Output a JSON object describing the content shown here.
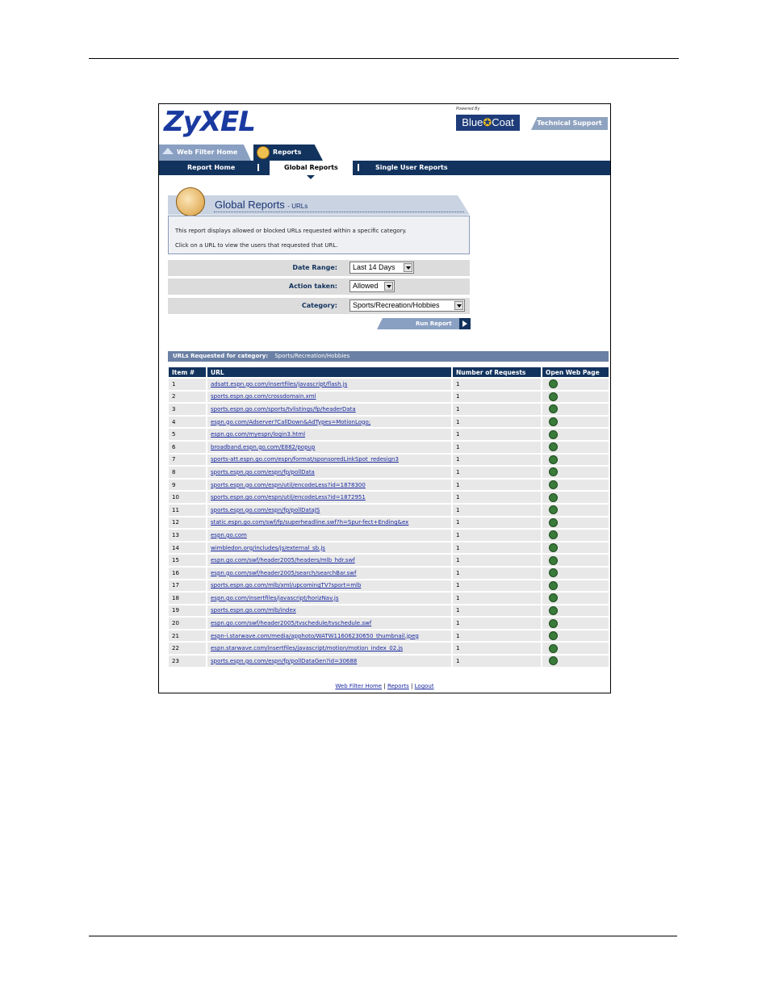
{
  "header": {
    "logo_text": "ZyXEL",
    "powered_by": "Powered By",
    "partner_logo": "BlueCoat",
    "tech_support_label": "Technical Support"
  },
  "tabs": [
    {
      "label": "Web Filter Home",
      "icon": "home-icon"
    },
    {
      "label": "Reports",
      "icon": "reports-icon"
    }
  ],
  "subnav": {
    "report_home": "Report Home",
    "global_reports": "Global Reports",
    "single_user_reports": "Single User Reports"
  },
  "section": {
    "title": "Global Reports",
    "subtitle": "- URLs",
    "desc_line1": "This report displays allowed or blocked URLs requested within a specific category.",
    "desc_line2": "Click on a URL to view the users that requested that URL."
  },
  "form": {
    "date_range_label": "Date Range:",
    "date_range_value": "Last 14 Days",
    "action_label": "Action taken:",
    "action_value": "Allowed",
    "category_label": "Category:",
    "category_value": "Sports/Recreation/Hobbies",
    "run_report_label": "Run Report"
  },
  "category_bar": {
    "label": "URLs Requested for category:",
    "value": "Sports/Recreation/Hobbies"
  },
  "table": {
    "headers": [
      "Item #",
      "URL",
      "Number of Requests",
      "Open Web Page"
    ],
    "rows": [
      [
        "1",
        "adsatt.espn.go.com/insertfiles/javascript/flash.js",
        "1"
      ],
      [
        "2",
        "sports.espn.go.com/crossdomain.xml",
        "1"
      ],
      [
        "3",
        "sports.espn.go.com/sports/tvlistings/fp/headerData",
        "1"
      ],
      [
        "4",
        "espn.go.com/Adserver?CallDown&AdTypes=MotionLogo;",
        "1"
      ],
      [
        "5",
        "espn.go.com/myespn/login3.html",
        "1"
      ],
      [
        "6",
        "broadband.espn.go.com/E882/popup",
        "1"
      ],
      [
        "7",
        "sports-att.espn.go.com/espn/format/sponsoredLinkSpot_redesign3",
        "1"
      ],
      [
        "8",
        "sports.espn.go.com/espn/fp/pollData",
        "1"
      ],
      [
        "9",
        "sports.espn.go.com/espn/util/encodeLess?id=1878300",
        "1"
      ],
      [
        "10",
        "sports.espn.go.com/espn/util/encodeLess?id=1872951",
        "1"
      ],
      [
        "11",
        "sports.espn.go.com/espn/fp/pollDataJS",
        "1"
      ],
      [
        "12",
        "static.espn.go.com/swf/fp/superheadline.swf?h=Spur-fect+Ending&ex",
        "1"
      ],
      [
        "13",
        "espn.go.com",
        "1"
      ],
      [
        "14",
        "wimbledon.org/includes/js/external_sb.js",
        "1"
      ],
      [
        "15",
        "espn.go.com/swf/header2005/headers/mlb_hdr.swf",
        "1"
      ],
      [
        "16",
        "espn.go.com/swf/header2005/search/searchBar.swf",
        "1"
      ],
      [
        "17",
        "sports.espn.go.com/mlb/xml/upcomingTV?sport=mlb",
        "1"
      ],
      [
        "18",
        "espn.go.com/insertfiles/javascript/horizNav.js",
        "1"
      ],
      [
        "19",
        "sports.espn.go.com/mlb/index",
        "1"
      ],
      [
        "20",
        "espn.go.com/swf/header2005/tvschedule/tvschedule.swf",
        "1"
      ],
      [
        "21",
        "espn-i.starwave.com/media/apphoto/WATW11606230650_thumbnail.jpeg",
        "1"
      ],
      [
        "22",
        "espn.starwave.com/insertfiles/javascript/motion/motion_index_02.js",
        "1"
      ],
      [
        "23",
        "sports.espn.go.com/espn/fp/pollDataGen?id=30688",
        "1"
      ]
    ]
  },
  "footer": {
    "links": [
      "Web Filter Home",
      "Reports",
      "Logout"
    ],
    "separator": "|"
  }
}
